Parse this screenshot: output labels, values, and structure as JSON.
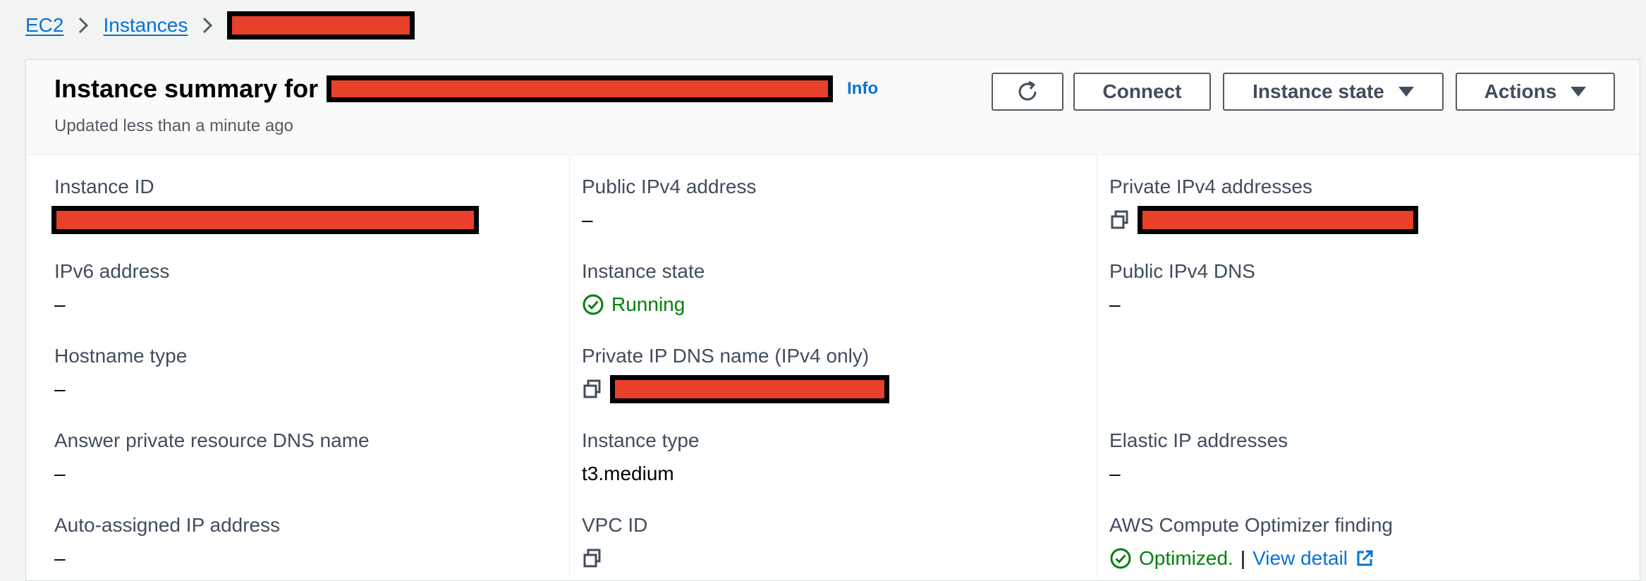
{
  "breadcrumb": {
    "items": [
      "EC2",
      "Instances"
    ]
  },
  "header": {
    "title": "Instance summary for",
    "info": "Info",
    "subtitle": "Updated less than a minute ago",
    "buttons": {
      "connect": "Connect",
      "instance_state": "Instance state",
      "actions": "Actions"
    }
  },
  "details": {
    "instance_id": {
      "label": "Instance ID"
    },
    "ipv6": {
      "label": "IPv6 address",
      "value": "–"
    },
    "hostname_type": {
      "label": "Hostname type",
      "value": "–"
    },
    "answer_dns": {
      "label": "Answer private resource DNS name",
      "value": "–"
    },
    "auto_ip": {
      "label": "Auto-assigned IP address",
      "value": "–"
    },
    "public_ipv4": {
      "label": "Public IPv4 address",
      "value": "–"
    },
    "instance_state": {
      "label": "Instance state",
      "value": "Running"
    },
    "private_dns": {
      "label": "Private IP DNS name (IPv4 only)"
    },
    "instance_type": {
      "label": "Instance type",
      "value": "t3.medium"
    },
    "vpc_id": {
      "label": "VPC ID"
    },
    "private_ipv4": {
      "label": "Private IPv4 addresses"
    },
    "public_dns": {
      "label": "Public IPv4 DNS",
      "value": "–"
    },
    "elastic_ip": {
      "label": "Elastic IP addresses",
      "value": "–"
    },
    "optimizer": {
      "label": "AWS Compute Optimizer finding",
      "value": "Optimized.",
      "separator": "|",
      "link": "View detail"
    }
  },
  "colors": {
    "link": "#0972d3",
    "success": "#037f0c",
    "redaction": "#e8402a"
  }
}
